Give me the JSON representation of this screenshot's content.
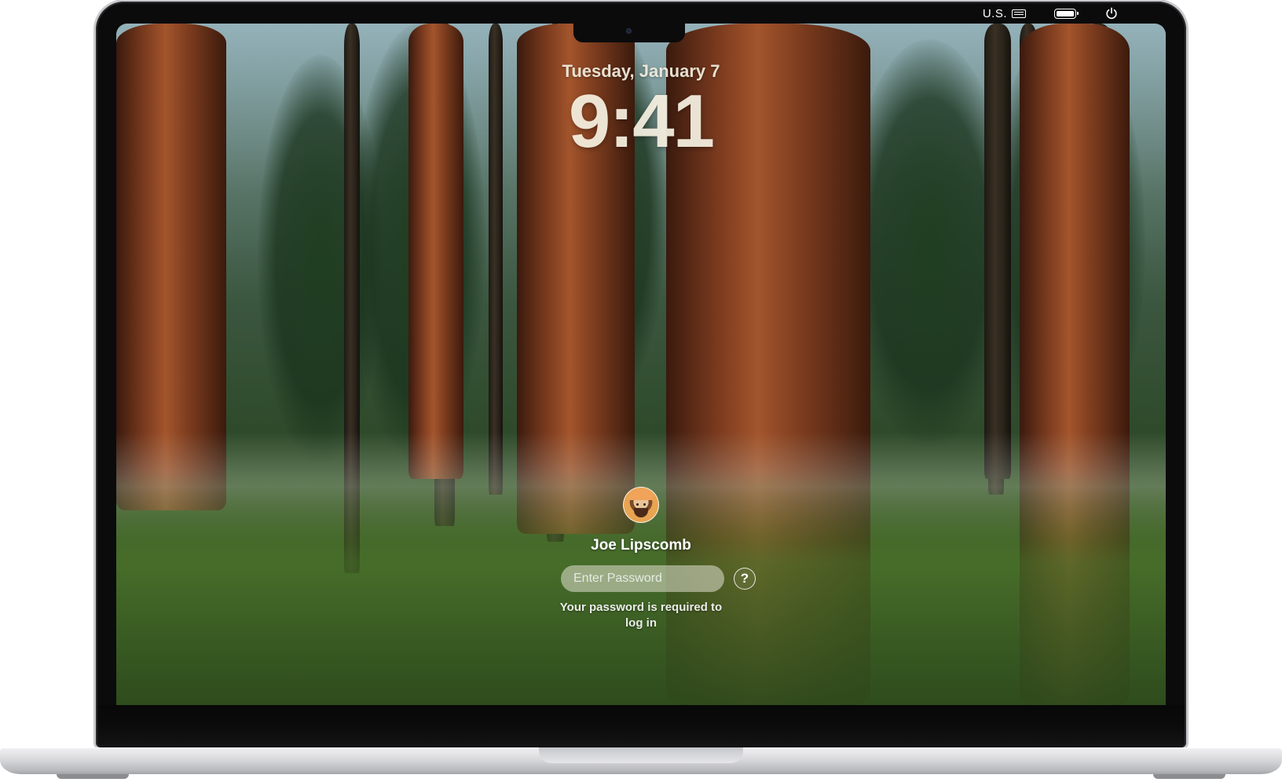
{
  "status_bar": {
    "input_source_label": "U.S.",
    "keyboard_icon": "keyboard-icon",
    "battery_icon": "battery-icon",
    "power_icon": "power-icon"
  },
  "lock_screen": {
    "date": "Tuesday, January 7",
    "time": "9:41"
  },
  "login": {
    "avatar_icon": "user-avatar",
    "username": "Joe Lipscomb",
    "password_placeholder": "Enter Password",
    "help_label": "?",
    "hint": "Your password is required to log in"
  }
}
